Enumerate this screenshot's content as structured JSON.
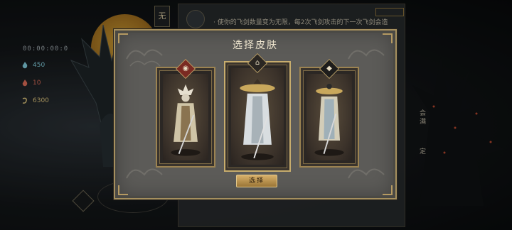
{
  "hud": {
    "timer": "00:00:00:0",
    "stats": [
      {
        "icon": "blue-flame-icon",
        "value": "450",
        "color": "#7fc9d8"
      },
      {
        "icon": "red-flame-icon",
        "value": "10",
        "color": "#d96a56"
      },
      {
        "icon": "gold-coin-icon",
        "value": "6300",
        "color": "#d8c07a"
      }
    ],
    "top_label": "无",
    "description": "· 使你的飞剑数量变为无限，每2次飞剑攻击的下一次飞剑会造",
    "right_texts": [
      "会",
      "满",
      "定"
    ]
  },
  "modal": {
    "title": "选择皮肤",
    "select_label": "选择",
    "skins": [
      {
        "badge_icon": "red-emblem-icon",
        "badge_symbol": "◉",
        "badge_color": "#7a2a22"
      },
      {
        "badge_icon": "hat-emblem-icon",
        "badge_symbol": "⌂",
        "badge_color": "#2a2622"
      },
      {
        "badge_icon": "diamond-emblem-icon",
        "badge_symbol": "◆",
        "badge_color": "#1e1d1c"
      }
    ]
  },
  "colors": {
    "frame_gold": "#a58f5e",
    "panel_gray": "#5c5b58",
    "button_gold": "#d8b06a"
  }
}
